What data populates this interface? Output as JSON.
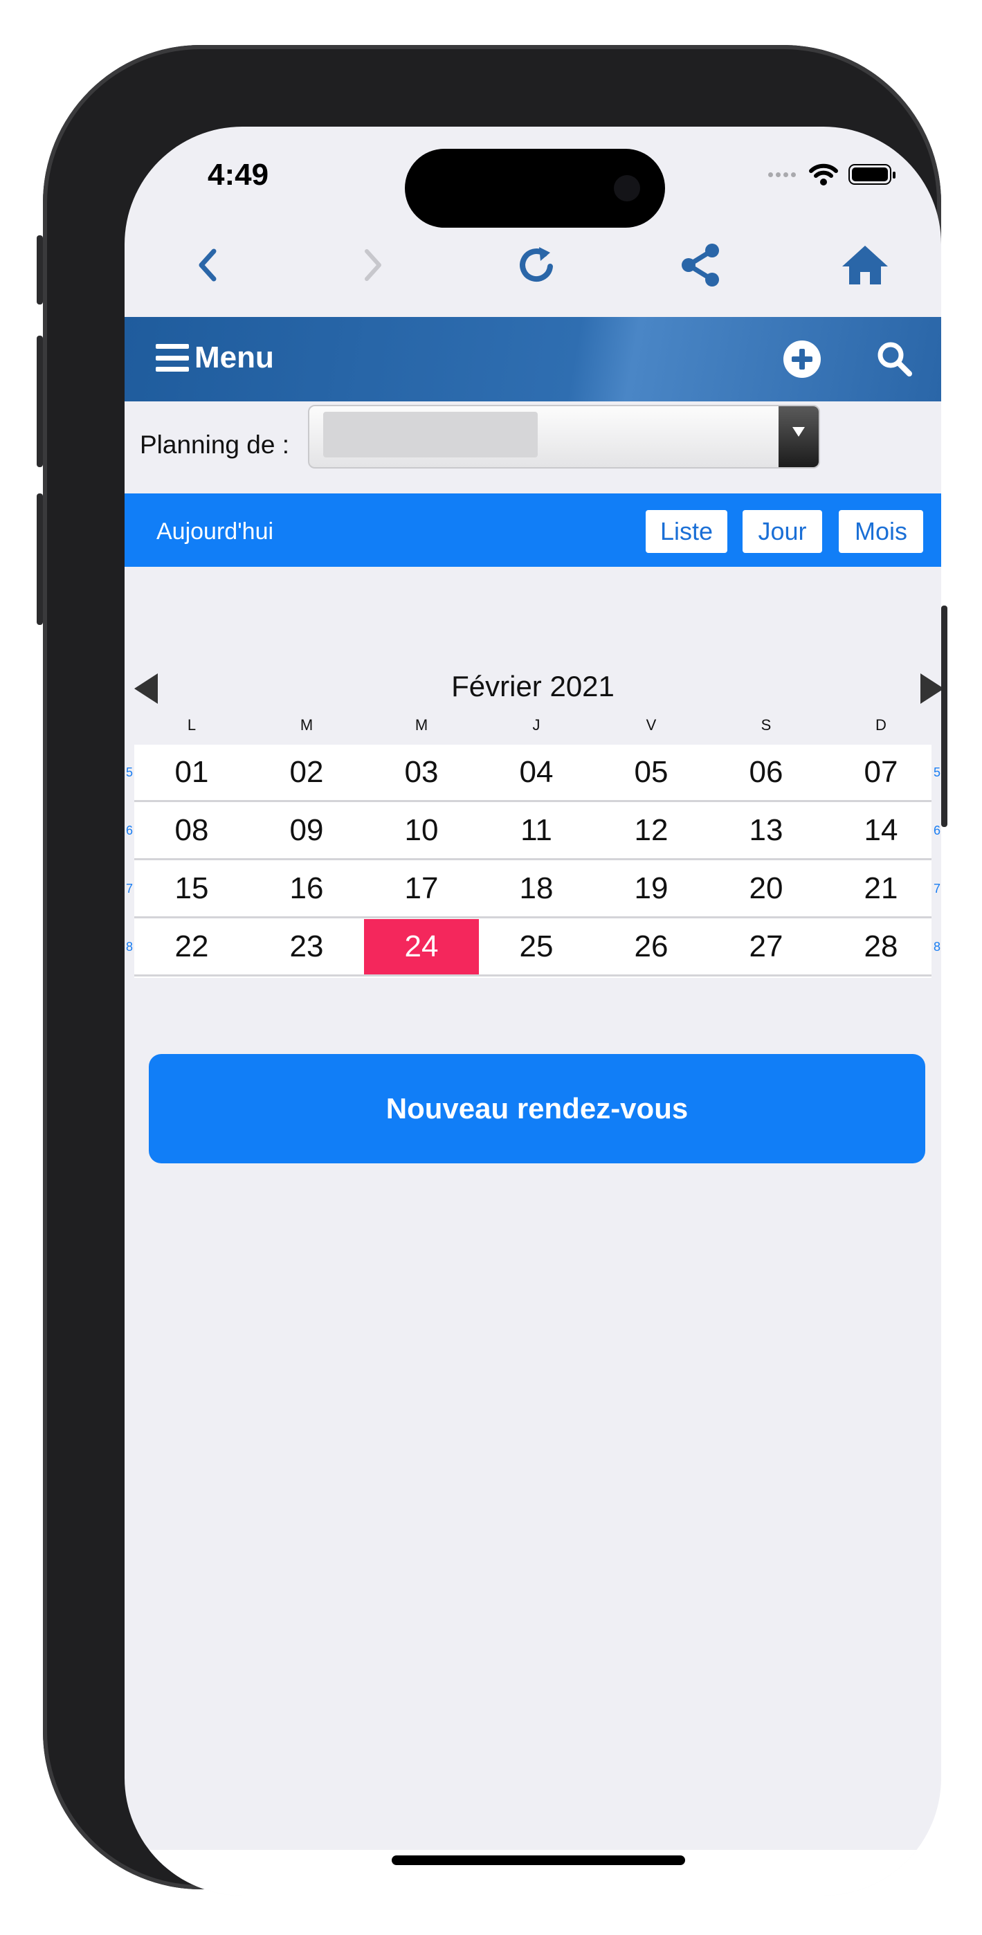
{
  "status": {
    "time": "4:49"
  },
  "nav": {
    "back_icon": "chevron-left-icon",
    "forward_icon": "chevron-right-icon",
    "reload_icon": "reload-icon",
    "share_icon": "share-icon",
    "home_icon": "home-icon"
  },
  "header": {
    "menu_label": "Menu",
    "add_icon": "plus-circle-icon",
    "search_icon": "search-icon",
    "color": "#2a66a8"
  },
  "planning": {
    "label": "Planning de :",
    "selected_value": ""
  },
  "view_bar": {
    "today_label": "Aujourd'hui",
    "views": [
      "Liste",
      "Jour",
      "Mois"
    ],
    "accent": "#117ef7"
  },
  "calendar": {
    "title": "Février 2021",
    "weekdays": [
      "L",
      "M",
      "M",
      "J",
      "V",
      "S",
      "D"
    ],
    "weeks": [
      {
        "number": "5",
        "days": [
          "01",
          "02",
          "03",
          "04",
          "05",
          "06",
          "07"
        ]
      },
      {
        "number": "6",
        "days": [
          "08",
          "09",
          "10",
          "11",
          "12",
          "13",
          "14"
        ]
      },
      {
        "number": "7",
        "days": [
          "15",
          "16",
          "17",
          "18",
          "19",
          "20",
          "21"
        ]
      },
      {
        "number": "8",
        "days": [
          "22",
          "23",
          "24",
          "25",
          "26",
          "27",
          "28"
        ]
      }
    ],
    "today": "24",
    "today_color": "#f4275c"
  },
  "actions": {
    "new_appointment": "Nouveau rendez-vous"
  }
}
